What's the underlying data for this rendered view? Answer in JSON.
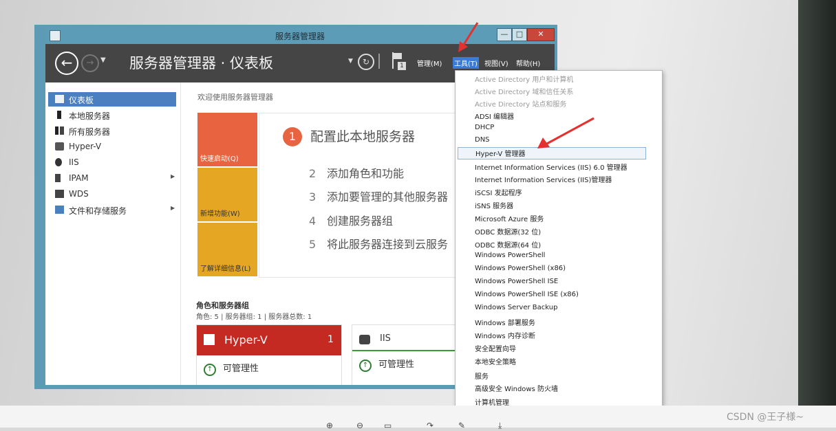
{
  "window": {
    "title": "服务器管理器"
  },
  "header": {
    "breadcrumb": "服务器管理器 · 仪表板",
    "notifications_count": "1",
    "menus": {
      "manage": "管理(M)",
      "tools": "工具(T)",
      "view": "视图(V)",
      "help": "帮助(H)"
    }
  },
  "sidebar": {
    "items": [
      {
        "label": "仪表板",
        "icon": "dashboard-grid-icon"
      },
      {
        "label": "本地服务器",
        "icon": "server-icon"
      },
      {
        "label": "所有服务器",
        "icon": "servers-icon"
      },
      {
        "label": "Hyper-V",
        "icon": "hyperv-icon"
      },
      {
        "label": "IIS",
        "icon": "iis-icon"
      },
      {
        "label": "IPAM",
        "icon": "ipam-icon"
      },
      {
        "label": "WDS",
        "icon": "wds-icon"
      },
      {
        "label": "文件和存储服务",
        "icon": "file-storage-icon"
      }
    ]
  },
  "main": {
    "welcome": "欢迎使用服务器管理器",
    "tiles": {
      "quick": "快速启动(Q)",
      "new": "新增功能(W)",
      "learn": "了解详细信息(L)"
    },
    "steps": [
      {
        "num": "1",
        "text": "配置此本地服务器"
      },
      {
        "num": "2",
        "text": "添加角色和功能"
      },
      {
        "num": "3",
        "text": "添加要管理的其他服务器"
      },
      {
        "num": "4",
        "text": "创建服务器组"
      },
      {
        "num": "5",
        "text": "将此服务器连接到云服务"
      }
    ],
    "roles_title": "角色和服务器组",
    "roles_summary": "角色: 5 | 服务器组: 1 | 服务器总数: 1",
    "cards": [
      {
        "name": "Hyper-V",
        "count": "1",
        "status": "可管理性"
      },
      {
        "name": "IIS",
        "status": "可管理性"
      }
    ]
  },
  "tools_menu": {
    "items": [
      "Active Directory 用户和计算机",
      "Active Directory 域和信任关系",
      "Active Directory 站点和服务",
      "ADSI 编辑器",
      "DHCP",
      "DNS",
      "Hyper-V 管理器",
      "Internet Information Services (IIS) 6.0 管理器",
      "Internet Information Services (IIS)管理器",
      "iSCSI 发起程序",
      "iSNS 服务器",
      "Microsoft Azure 服务",
      "ODBC 数据源(32 位)",
      "ODBC 数据源(64 位)",
      "Windows PowerShell",
      "Windows PowerShell (x86)",
      "Windows PowerShell ISE",
      "Windows PowerShell ISE (x86)",
      "Windows Server Backup",
      "Windows 部署服务",
      "Windows 内存诊断",
      "安全配置向导",
      "本地安全策略",
      "服务",
      "高级安全 Windows 防火墙",
      "计算机管理"
    ],
    "highlighted": "Hyper-V 管理器"
  },
  "watermark": "CSDN @王子様~",
  "colors": {
    "header_bg": "#454545",
    "accent_blue": "#4a7fc0",
    "tile_orange": "#e8633f",
    "tile_yellow": "#e5a624",
    "hyperv_red": "#c42a22",
    "arrow_red": "#e53030"
  }
}
